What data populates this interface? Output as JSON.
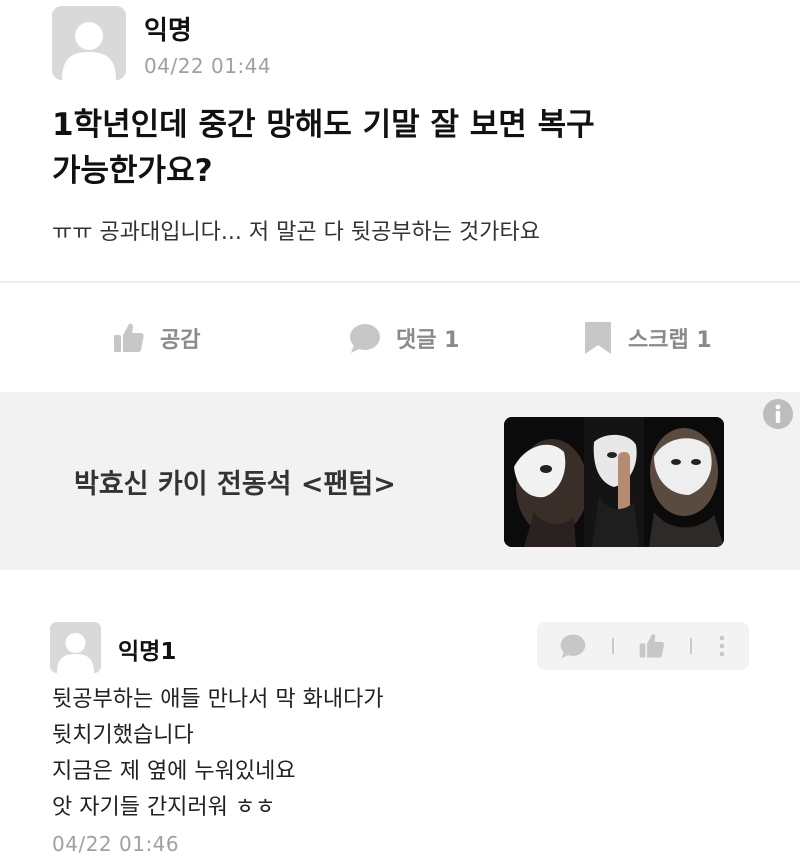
{
  "post": {
    "author": "익명",
    "timestamp": "04/22 01:44",
    "title_lines": [
      "1학년인데 중간 망해도 기말 잘 보면 복구",
      "가능한가요?"
    ],
    "body": "ㅠㅠ 공과대입니다... 저 말곤 다 뒷공부하는 것가타요"
  },
  "actions": {
    "like_label": "공감",
    "comment_label": "댓글 1",
    "scrap_label": "스크랩 1",
    "icon_color": "#c7c7c7"
  },
  "ad": {
    "text": "박효신 카이 전동석 <팬텀>",
    "info_icon": "info-icon",
    "image_icon": "phantom-mask-poster"
  },
  "comment": {
    "author": "익명1",
    "lines": [
      "뒷공부하는 애들 만나서 막 화내다가",
      "뒷치기했습니다",
      "지금은 제 옆에 누워있네요",
      "앗 자기들 간지러워 ㅎㅎ"
    ],
    "timestamp": "04/22 01:46",
    "action_icons": [
      "comment-icon",
      "like-icon",
      "more-icon"
    ]
  },
  "colors": {
    "avatar_bg": "#d9d9d9",
    "muted_text": "#a0a0a0",
    "ad_bg": "#f2f2f2"
  }
}
